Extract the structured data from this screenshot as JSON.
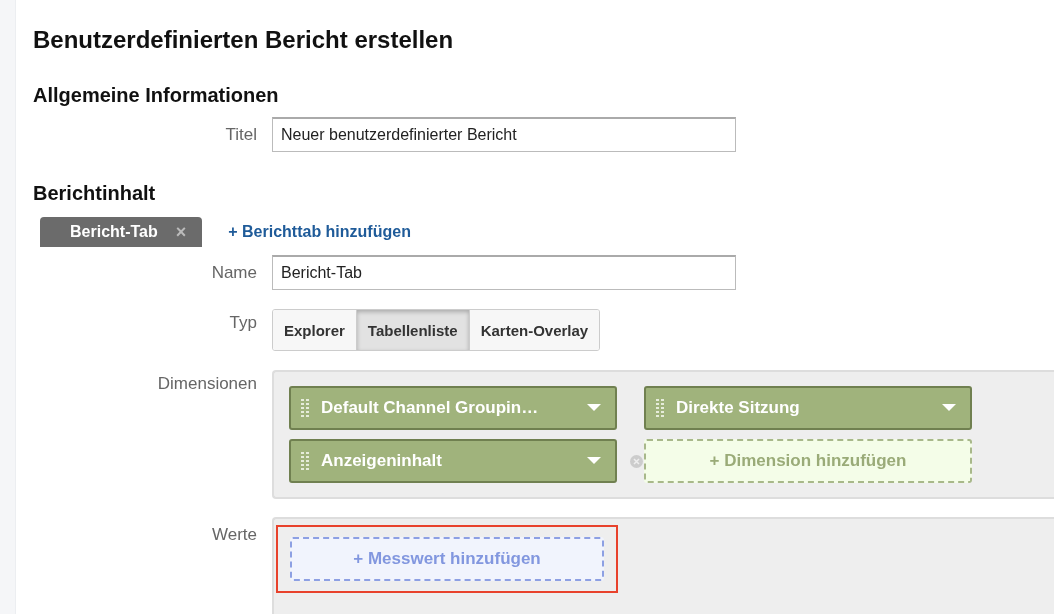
{
  "page_title": "Benutzerdefinierten Bericht erstellen",
  "general": {
    "heading": "Allgemeine Informationen",
    "title_field": {
      "label": "Titel",
      "value": "Neuer benutzerdefinierter Bericht"
    }
  },
  "content": {
    "heading": "Berichtinhalt",
    "tabs": [
      {
        "label": "Bericht-Tab",
        "close": "×",
        "selected": true
      }
    ],
    "add_tab": "+ Berichttab hinzufügen",
    "name_field": {
      "label": "Name",
      "value": "Bericht-Tab"
    },
    "type": {
      "label": "Typ",
      "options": [
        {
          "label": "Explorer",
          "selected": false
        },
        {
          "label": "Tabellenliste",
          "selected": true
        },
        {
          "label": "Karten-Overlay",
          "selected": false
        }
      ]
    },
    "dimensions": {
      "label": "Dimensionen",
      "items": [
        "Default Channel Groupin…",
        "Direkte Sitzung",
        "Anzeigeninhalt"
      ],
      "add": "+ Dimension hinzufügen"
    },
    "metrics": {
      "label": "Werte",
      "add": "+ Messwert hinzufügen",
      "highlighted": true
    }
  }
}
